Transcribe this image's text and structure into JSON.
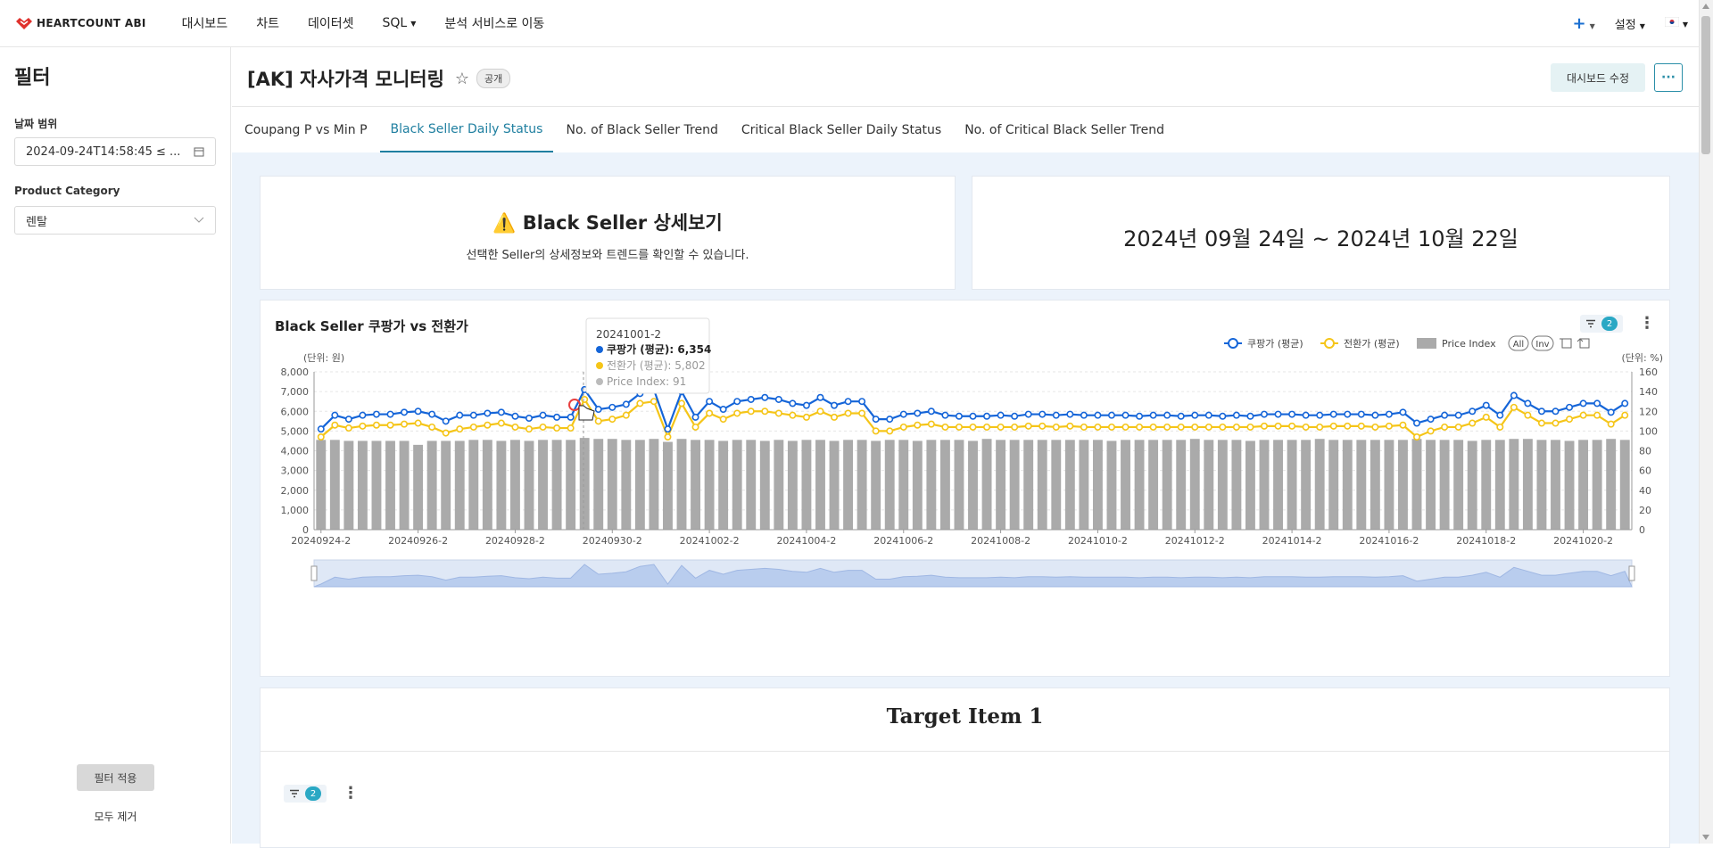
{
  "app": {
    "brand": "HEARTCOUNT ABI",
    "nav": [
      "대시보드",
      "차트",
      "데이터셋",
      "SQL",
      "분석 서비스로 이동"
    ],
    "settings_label": "설정",
    "lang_flag": "🇰🇷"
  },
  "sidebar": {
    "title": "필터",
    "date_label": "날짜 범위",
    "date_value": "2024-09-24T14:58:45 ≤ ...",
    "category_label": "Product Category",
    "category_value": "렌탈",
    "apply_label": "필터 적용",
    "clear_label": "모두 제거"
  },
  "dashboard": {
    "title": "[AK] 자사가격 모니터링",
    "visibility": "공개",
    "edit_label": "대시보드 수정",
    "more_label": "···",
    "tabs": [
      "Coupang P vs Min P",
      "Black Seller Daily Status",
      "No. of Black Seller Trend",
      "Critical Black Seller Daily Status",
      "No. of Critical Black Seller Trend"
    ],
    "active_tab": 1
  },
  "info_card": {
    "icon": "warning-icon",
    "title": "Black Seller 상세보기",
    "subtitle": "선택한 Seller의 상세정보와 트렌드를 확인할 수 있습니다."
  },
  "date_card": {
    "text": "2024년 09월 24일 ~ 2024년 10월 22일"
  },
  "chart_card": {
    "title": "Black Seller 쿠팡가 vs 전환가",
    "filter_count": "2",
    "tooltip": {
      "header": "20241001-2",
      "rows": [
        {
          "label": "쿠팡가 (평균)",
          "value": "6,354",
          "color": "#1565d8"
        },
        {
          "label": "전환가 (평균)",
          "value": "5,802",
          "color": "#f5c518"
        },
        {
          "label": "Price Index",
          "value": "91",
          "color": "#aaaaaa"
        }
      ]
    },
    "legend_all": "All",
    "legend_inv": "Inv"
  },
  "chart_data": {
    "type": "bar+line",
    "y_left_unit": "(단위: 원)",
    "y_right_unit": "(단위: %)",
    "y_left_ticks": [
      "8,000",
      "7,000",
      "6,000",
      "5,000",
      "4,000",
      "3,000",
      "2,000",
      "1,000",
      "0"
    ],
    "y_right_ticks": [
      "160",
      "140",
      "120",
      "100",
      "80",
      "60",
      "40",
      "20",
      "0"
    ],
    "ylim_left": [
      0,
      8000
    ],
    "ylim_right": [
      0,
      160
    ],
    "x_tick_labels": [
      "20240924-2",
      "20240926-2",
      "20240928-2",
      "20240930-2",
      "20241002-2",
      "20241004-2",
      "20241006-2",
      "20241008-2",
      "20241010-2",
      "20241012-2",
      "20241014-2",
      "20241016-2",
      "20241018-2",
      "20241020-2"
    ],
    "series": [
      {
        "name": "쿠팡가 (평균)",
        "type": "line",
        "color": "#1565d8",
        "values": [
          5100,
          5800,
          5600,
          5800,
          5850,
          5850,
          5950,
          6000,
          5850,
          5500,
          5800,
          5800,
          5900,
          5950,
          5750,
          5650,
          5800,
          5700,
          5700,
          7100,
          6100,
          6200,
          6354,
          6900,
          7100,
          5100,
          7000,
          5700,
          6500,
          6100,
          6500,
          6600,
          6700,
          6600,
          6400,
          6300,
          6700,
          6300,
          6500,
          6500,
          5600,
          5600,
          5850,
          5900,
          6000,
          5800,
          5750,
          5750,
          5750,
          5800,
          5750,
          5850,
          5850,
          5800,
          5850,
          5800,
          5800,
          5800,
          5800,
          5750,
          5800,
          5800,
          5750,
          5800,
          5800,
          5750,
          5800,
          5750,
          5850,
          5850,
          5850,
          5800,
          5800,
          5850,
          5850,
          5850,
          5800,
          5850,
          5950,
          5400,
          5600,
          5800,
          5800,
          6000,
          6300,
          5800,
          6800,
          6400,
          6000,
          6000,
          6200,
          6400,
          6400,
          5950,
          6400
        ]
      },
      {
        "name": "전환가 (평균)",
        "type": "line",
        "color": "#f5c518",
        "values": [
          4700,
          5300,
          5150,
          5250,
          5300,
          5300,
          5350,
          5400,
          5200,
          4900,
          5100,
          5200,
          5300,
          5400,
          5200,
          5100,
          5200,
          5150,
          5150,
          6600,
          5500,
          5600,
          5802,
          6400,
          6500,
          4700,
          6400,
          5200,
          5900,
          5600,
          5900,
          6000,
          6000,
          5900,
          5800,
          5700,
          6000,
          5700,
          5900,
          5900,
          5000,
          5000,
          5200,
          5300,
          5350,
          5200,
          5200,
          5200,
          5200,
          5200,
          5200,
          5250,
          5250,
          5200,
          5250,
          5200,
          5200,
          5200,
          5200,
          5200,
          5200,
          5200,
          5200,
          5200,
          5200,
          5200,
          5200,
          5200,
          5250,
          5250,
          5250,
          5200,
          5200,
          5250,
          5250,
          5250,
          5200,
          5250,
          5300,
          4700,
          5000,
          5200,
          5200,
          5400,
          5700,
          5200,
          6200,
          5800,
          5400,
          5400,
          5600,
          5800,
          5800,
          5350,
          5800
        ]
      },
      {
        "name": "Price Index",
        "type": "bar",
        "color": "#aaaaaa",
        "axis": "right",
        "values": [
          91,
          91,
          90,
          90,
          90,
          90,
          90,
          86,
          90,
          90,
          90,
          91,
          91,
          90,
          91,
          90,
          91,
          91,
          91,
          93,
          92,
          92,
          91,
          91,
          92,
          89,
          92,
          91,
          91,
          90,
          91,
          91,
          90,
          91,
          90,
          91,
          91,
          90,
          91,
          91,
          90,
          91,
          91,
          90,
          91,
          91,
          91,
          90,
          92,
          91,
          91,
          91,
          91,
          91,
          91,
          91,
          91,
          90,
          91,
          91,
          91,
          91,
          91,
          92,
          91,
          91,
          91,
          90,
          91,
          91,
          91,
          91,
          92,
          91,
          91,
          91,
          91,
          91,
          91,
          92,
          91,
          91,
          91,
          90,
          91,
          91,
          92,
          92,
          91,
          91,
          90,
          91,
          91,
          92,
          91
        ]
      }
    ]
  },
  "target_card": {
    "title": "Target Item 1",
    "filter_count": "2"
  }
}
